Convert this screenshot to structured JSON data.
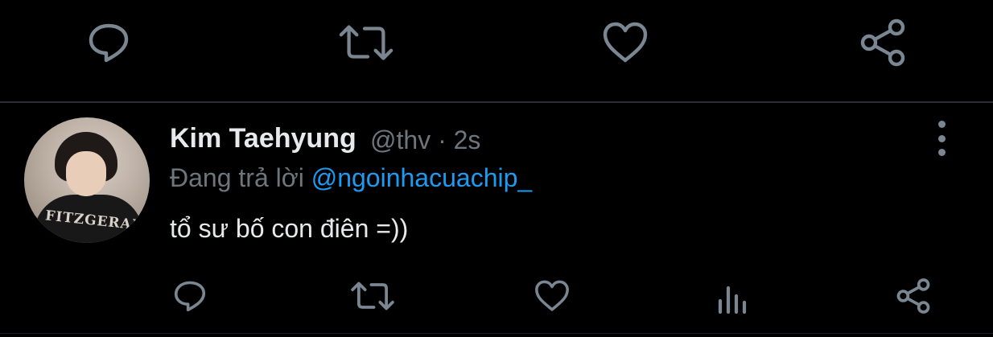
{
  "previous_tweet": {
    "actions": [
      {
        "name": "reply",
        "icon": "reply-icon"
      },
      {
        "name": "retweet",
        "icon": "retweet-icon"
      },
      {
        "name": "like",
        "icon": "heart-icon"
      },
      {
        "name": "share",
        "icon": "share-icon"
      }
    ]
  },
  "tweet": {
    "display_name": "Kim Taehyung",
    "handle": "@thv",
    "separator": "·",
    "time": "2s",
    "reply_prefix": "Đang trả lời",
    "reply_to": "@ngoinhacuachip_",
    "text": "tổ sư bố con điên =))",
    "avatar_shirt_text": "FITZGERALD",
    "actions": [
      {
        "name": "reply",
        "icon": "reply-icon"
      },
      {
        "name": "retweet",
        "icon": "retweet-icon"
      },
      {
        "name": "like",
        "icon": "heart-icon"
      },
      {
        "name": "analytics",
        "icon": "bar-chart-icon"
      },
      {
        "name": "share",
        "icon": "share-icon"
      }
    ],
    "more_icon": "more-vertical-icon"
  },
  "colors": {
    "background": "#000000",
    "primary_text": "#e7e9ea",
    "secondary_text": "#6e767d",
    "mention": "#1d9bf0",
    "icon": "#7a8691",
    "divider": "#2b3036"
  }
}
